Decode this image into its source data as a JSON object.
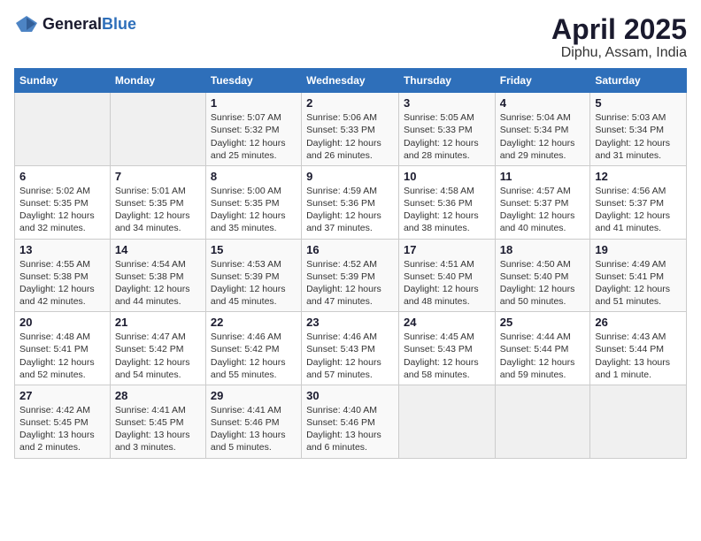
{
  "header": {
    "logo_general": "General",
    "logo_blue": "Blue",
    "title": "April 2025",
    "subtitle": "Diphu, Assam, India"
  },
  "days_of_week": [
    "Sunday",
    "Monday",
    "Tuesday",
    "Wednesday",
    "Thursday",
    "Friday",
    "Saturday"
  ],
  "weeks": [
    [
      {
        "day": "",
        "info": ""
      },
      {
        "day": "",
        "info": ""
      },
      {
        "day": "1",
        "info": "Sunrise: 5:07 AM\nSunset: 5:32 PM\nDaylight: 12 hours and 25 minutes."
      },
      {
        "day": "2",
        "info": "Sunrise: 5:06 AM\nSunset: 5:33 PM\nDaylight: 12 hours and 26 minutes."
      },
      {
        "day": "3",
        "info": "Sunrise: 5:05 AM\nSunset: 5:33 PM\nDaylight: 12 hours and 28 minutes."
      },
      {
        "day": "4",
        "info": "Sunrise: 5:04 AM\nSunset: 5:34 PM\nDaylight: 12 hours and 29 minutes."
      },
      {
        "day": "5",
        "info": "Sunrise: 5:03 AM\nSunset: 5:34 PM\nDaylight: 12 hours and 31 minutes."
      }
    ],
    [
      {
        "day": "6",
        "info": "Sunrise: 5:02 AM\nSunset: 5:35 PM\nDaylight: 12 hours and 32 minutes."
      },
      {
        "day": "7",
        "info": "Sunrise: 5:01 AM\nSunset: 5:35 PM\nDaylight: 12 hours and 34 minutes."
      },
      {
        "day": "8",
        "info": "Sunrise: 5:00 AM\nSunset: 5:35 PM\nDaylight: 12 hours and 35 minutes."
      },
      {
        "day": "9",
        "info": "Sunrise: 4:59 AM\nSunset: 5:36 PM\nDaylight: 12 hours and 37 minutes."
      },
      {
        "day": "10",
        "info": "Sunrise: 4:58 AM\nSunset: 5:36 PM\nDaylight: 12 hours and 38 minutes."
      },
      {
        "day": "11",
        "info": "Sunrise: 4:57 AM\nSunset: 5:37 PM\nDaylight: 12 hours and 40 minutes."
      },
      {
        "day": "12",
        "info": "Sunrise: 4:56 AM\nSunset: 5:37 PM\nDaylight: 12 hours and 41 minutes."
      }
    ],
    [
      {
        "day": "13",
        "info": "Sunrise: 4:55 AM\nSunset: 5:38 PM\nDaylight: 12 hours and 42 minutes."
      },
      {
        "day": "14",
        "info": "Sunrise: 4:54 AM\nSunset: 5:38 PM\nDaylight: 12 hours and 44 minutes."
      },
      {
        "day": "15",
        "info": "Sunrise: 4:53 AM\nSunset: 5:39 PM\nDaylight: 12 hours and 45 minutes."
      },
      {
        "day": "16",
        "info": "Sunrise: 4:52 AM\nSunset: 5:39 PM\nDaylight: 12 hours and 47 minutes."
      },
      {
        "day": "17",
        "info": "Sunrise: 4:51 AM\nSunset: 5:40 PM\nDaylight: 12 hours and 48 minutes."
      },
      {
        "day": "18",
        "info": "Sunrise: 4:50 AM\nSunset: 5:40 PM\nDaylight: 12 hours and 50 minutes."
      },
      {
        "day": "19",
        "info": "Sunrise: 4:49 AM\nSunset: 5:41 PM\nDaylight: 12 hours and 51 minutes."
      }
    ],
    [
      {
        "day": "20",
        "info": "Sunrise: 4:48 AM\nSunset: 5:41 PM\nDaylight: 12 hours and 52 minutes."
      },
      {
        "day": "21",
        "info": "Sunrise: 4:47 AM\nSunset: 5:42 PM\nDaylight: 12 hours and 54 minutes."
      },
      {
        "day": "22",
        "info": "Sunrise: 4:46 AM\nSunset: 5:42 PM\nDaylight: 12 hours and 55 minutes."
      },
      {
        "day": "23",
        "info": "Sunrise: 4:46 AM\nSunset: 5:43 PM\nDaylight: 12 hours and 57 minutes."
      },
      {
        "day": "24",
        "info": "Sunrise: 4:45 AM\nSunset: 5:43 PM\nDaylight: 12 hours and 58 minutes."
      },
      {
        "day": "25",
        "info": "Sunrise: 4:44 AM\nSunset: 5:44 PM\nDaylight: 12 hours and 59 minutes."
      },
      {
        "day": "26",
        "info": "Sunrise: 4:43 AM\nSunset: 5:44 PM\nDaylight: 13 hours and 1 minute."
      }
    ],
    [
      {
        "day": "27",
        "info": "Sunrise: 4:42 AM\nSunset: 5:45 PM\nDaylight: 13 hours and 2 minutes."
      },
      {
        "day": "28",
        "info": "Sunrise: 4:41 AM\nSunset: 5:45 PM\nDaylight: 13 hours and 3 minutes."
      },
      {
        "day": "29",
        "info": "Sunrise: 4:41 AM\nSunset: 5:46 PM\nDaylight: 13 hours and 5 minutes."
      },
      {
        "day": "30",
        "info": "Sunrise: 4:40 AM\nSunset: 5:46 PM\nDaylight: 13 hours and 6 minutes."
      },
      {
        "day": "",
        "info": ""
      },
      {
        "day": "",
        "info": ""
      },
      {
        "day": "",
        "info": ""
      }
    ]
  ]
}
